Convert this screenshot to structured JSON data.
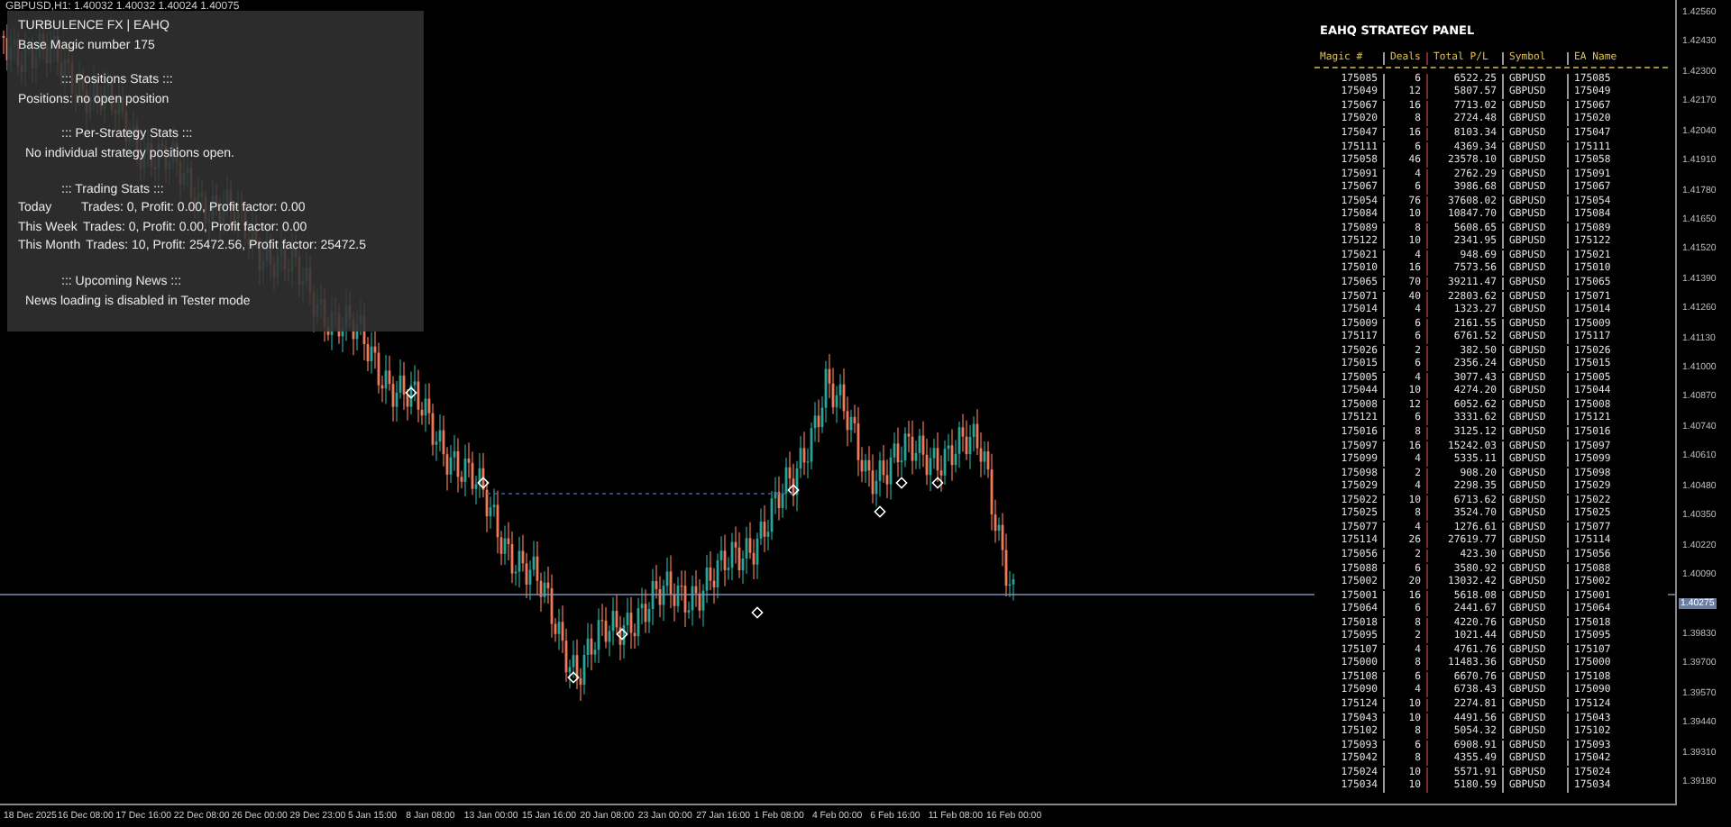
{
  "chart_header": "GBPUSD,H1: 1.40032 1.40032 1.40024 1.40075",
  "info_panel": {
    "lines": [
      {
        "kind": "title",
        "text": "TURBULENCE FX | EAHQ"
      },
      {
        "kind": "plain",
        "text": "Base Magic number 175"
      },
      {
        "kind": "section",
        "text": "::: Positions Stats :::"
      },
      {
        "kind": "plain",
        "text": "Positions: no open position"
      },
      {
        "kind": "section",
        "text": "::: Per-Strategy Stats :::"
      },
      {
        "kind": "indent",
        "text": "No individual strategy positions open."
      },
      {
        "kind": "section",
        "text": "::: Trading Stats :::"
      },
      {
        "kind": "stat",
        "label": "Today",
        "text": "Trades: 0, Profit: 0.00, Profit factor: 0.00"
      },
      {
        "kind": "stat",
        "label": "This Week",
        "text": "Trades: 0, Profit: 0.00, Profit factor: 0.00"
      },
      {
        "kind": "stat",
        "label": "This Month",
        "text": "Trades: 10, Profit: 25472.56, Profit factor: 25472.5"
      },
      {
        "kind": "section",
        "text": "::: Upcoming News :::"
      },
      {
        "kind": "indent",
        "text": "News loading is disabled in Tester mode"
      }
    ]
  },
  "strategy_panel": {
    "title": "EAHQ STRATEGY PANEL",
    "columns": [
      "Magic #",
      "Deals",
      "Total P/L",
      "Symbol",
      "EA Name"
    ],
    "rows": [
      [
        "175085",
        "6",
        "6522.25",
        "GBPUSD",
        "175085"
      ],
      [
        "175049",
        "12",
        "5807.57",
        "GBPUSD",
        "175049"
      ],
      [
        "175067",
        "16",
        "7713.02",
        "GBPUSD",
        "175067"
      ],
      [
        "175020",
        "8",
        "2724.48",
        "GBPUSD",
        "175020"
      ],
      [
        "175047",
        "16",
        "8103.34",
        "GBPUSD",
        "175047"
      ],
      [
        "175111",
        "6",
        "4369.34",
        "GBPUSD",
        "175111"
      ],
      [
        "175058",
        "46",
        "23578.10",
        "GBPUSD",
        "175058"
      ],
      [
        "175091",
        "4",
        "2762.29",
        "GBPUSD",
        "175091"
      ],
      [
        "175067",
        "6",
        "3986.68",
        "GBPUSD",
        "175067"
      ],
      [
        "175054",
        "76",
        "37608.02",
        "GBPUSD",
        "175054"
      ],
      [
        "175084",
        "10",
        "10847.70",
        "GBPUSD",
        "175084"
      ],
      [
        "175089",
        "8",
        "5608.65",
        "GBPUSD",
        "175089"
      ],
      [
        "175122",
        "10",
        "2341.95",
        "GBPUSD",
        "175122"
      ],
      [
        "175021",
        "4",
        "948.69",
        "GBPUSD",
        "175021"
      ],
      [
        "175010",
        "16",
        "7573.56",
        "GBPUSD",
        "175010"
      ],
      [
        "175065",
        "70",
        "39211.47",
        "GBPUSD",
        "175065"
      ],
      [
        "175071",
        "40",
        "22803.62",
        "GBPUSD",
        "175071"
      ],
      [
        "175014",
        "4",
        "1323.27",
        "GBPUSD",
        "175014"
      ],
      [
        "175009",
        "6",
        "2161.55",
        "GBPUSD",
        "175009"
      ],
      [
        "175117",
        "6",
        "6761.52",
        "GBPUSD",
        "175117"
      ],
      [
        "175026",
        "2",
        "382.50",
        "GBPUSD",
        "175026"
      ],
      [
        "175015",
        "6",
        "2356.24",
        "GBPUSD",
        "175015"
      ],
      [
        "175005",
        "4",
        "3077.43",
        "GBPUSD",
        "175005"
      ],
      [
        "175044",
        "10",
        "4274.20",
        "GBPUSD",
        "175044"
      ],
      [
        "175008",
        "12",
        "6052.62",
        "GBPUSD",
        "175008"
      ],
      [
        "175121",
        "6",
        "3331.62",
        "GBPUSD",
        "175121"
      ],
      [
        "175016",
        "8",
        "3125.12",
        "GBPUSD",
        "175016"
      ],
      [
        "175097",
        "16",
        "15242.03",
        "GBPUSD",
        "175097"
      ],
      [
        "175099",
        "4",
        "5335.11",
        "GBPUSD",
        "175099"
      ],
      [
        "175098",
        "2",
        "908.20",
        "GBPUSD",
        "175098"
      ],
      [
        "175029",
        "4",
        "2298.35",
        "GBPUSD",
        "175029"
      ],
      [
        "175022",
        "10",
        "6713.62",
        "GBPUSD",
        "175022"
      ],
      [
        "175025",
        "8",
        "3524.70",
        "GBPUSD",
        "175025"
      ],
      [
        "175077",
        "4",
        "1276.61",
        "GBPUSD",
        "175077"
      ],
      [
        "175114",
        "26",
        "27619.77",
        "GBPUSD",
        "175114"
      ],
      [
        "175056",
        "2",
        "423.30",
        "GBPUSD",
        "175056"
      ],
      [
        "175088",
        "6",
        "3580.92",
        "GBPUSD",
        "175088"
      ],
      [
        "175002",
        "20",
        "13032.42",
        "GBPUSD",
        "175002"
      ],
      [
        "175001",
        "16",
        "5618.08",
        "GBPUSD",
        "175001"
      ],
      [
        "175064",
        "6",
        "2441.67",
        "GBPUSD",
        "175064"
      ],
      [
        "175018",
        "8",
        "4220.76",
        "GBPUSD",
        "175018"
      ],
      [
        "175095",
        "2",
        "1021.44",
        "GBPUSD",
        "175095"
      ],
      [
        "175107",
        "4",
        "4761.76",
        "GBPUSD",
        "175107"
      ],
      [
        "175000",
        "8",
        "11483.36",
        "GBPUSD",
        "175000"
      ],
      [
        "175108",
        "6",
        "6670.76",
        "GBPUSD",
        "175108"
      ],
      [
        "175090",
        "4",
        "6738.43",
        "GBPUSD",
        "175090"
      ],
      [
        "175124",
        "10",
        "2274.81",
        "GBPUSD",
        "175124"
      ],
      [
        "175043",
        "10",
        "4491.56",
        "GBPUSD",
        "175043"
      ],
      [
        "175102",
        "8",
        "5054.32",
        "GBPUSD",
        "175102"
      ],
      [
        "175093",
        "6",
        "6908.91",
        "GBPUSD",
        "175093"
      ],
      [
        "175042",
        "8",
        "4355.49",
        "GBPUSD",
        "175042"
      ],
      [
        "175024",
        "10",
        "5571.91",
        "GBPUSD",
        "175024"
      ],
      [
        "175034",
        "10",
        "5180.59",
        "GBPUSD",
        "175034"
      ]
    ]
  },
  "price_axis": {
    "labels": [
      {
        "kind": "tick",
        "text": "1.42560"
      },
      {
        "kind": "tick",
        "text": "1.42430"
      },
      {
        "kind": "tick",
        "text": "1.42300"
      },
      {
        "kind": "tick",
        "text": "1.42170"
      },
      {
        "kind": "tick",
        "text": "1.42040"
      },
      {
        "kind": "tick",
        "text": "1.41910"
      },
      {
        "kind": "tick",
        "text": "1.41780"
      },
      {
        "kind": "tick",
        "text": "1.41650"
      },
      {
        "kind": "tick",
        "text": "1.41520"
      },
      {
        "kind": "tick",
        "text": "1.41390"
      },
      {
        "kind": "tick",
        "text": "1.41260"
      },
      {
        "kind": "tick",
        "text": "1.41130"
      },
      {
        "kind": "tick",
        "text": "1.41000"
      },
      {
        "kind": "tick",
        "text": "1.40870"
      },
      {
        "kind": "tick",
        "text": "1.40740"
      },
      {
        "kind": "tick",
        "text": "1.40610"
      },
      {
        "kind": "tick",
        "text": "1.40480"
      },
      {
        "kind": "tick",
        "text": "1.40350"
      },
      {
        "kind": "tick",
        "text": "1.40220"
      },
      {
        "kind": "tick",
        "text": "1.40090"
      },
      {
        "kind": "current",
        "text": "1.40275"
      },
      {
        "kind": "tick",
        "text": "1.39830"
      },
      {
        "kind": "tick",
        "text": "1.39700"
      },
      {
        "kind": "tick",
        "text": "1.39570"
      },
      {
        "kind": "tick",
        "text": "1.39440"
      },
      {
        "kind": "tick",
        "text": "1.39310"
      },
      {
        "kind": "tick",
        "text": "1.39180"
      }
    ]
  },
  "time_axis": {
    "labels": [
      "18 Dec 2025",
      "16 Dec 08:00",
      "17 Dec 16:00",
      "22 Dec 08:00",
      "26 Dec 00:00",
      "29 Dec 23:00",
      "5 Jan 15:00",
      "8 Jan 08:00",
      "13 Jan 00:00",
      "15 Jan 16:00",
      "20 Jan 08:00",
      "23 Jan 00:00",
      "27 Jan 16:00",
      "1 Feb 08:00",
      "4 Feb 00:00",
      "6 Feb 16:00",
      "11 Feb 08:00",
      "16 Feb 00:00"
    ]
  }
}
